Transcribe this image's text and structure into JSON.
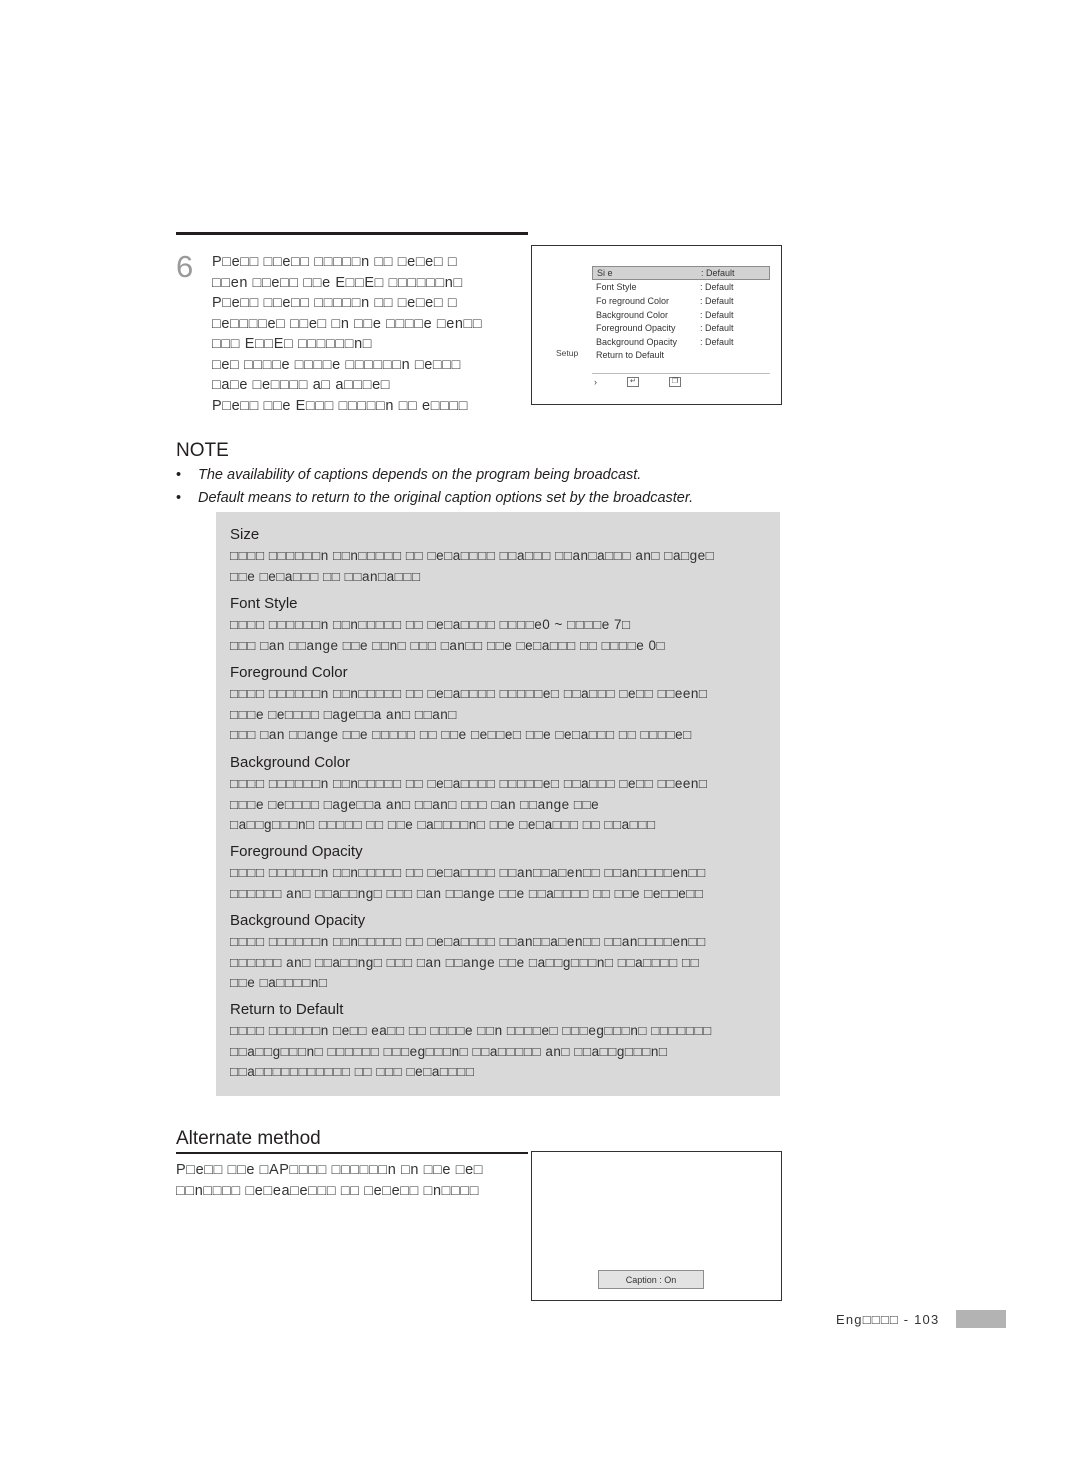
{
  "step": {
    "number": "6",
    "text": "P□e□□ □□e□□  □□□□□n □□ □e□e□ □\n□□en □□e□□ □□e E□□E□ □□□□□□n□\nP□e□□ □□e□□  □□□□□n □□ □e□e□ □\n□e□□□□e□ □□e□ □n □□e □□□□e □en□□\n□□□ E□□E□ □□□□□□n□\n□e□ □□□□e □□□□e □□□□□□n □e□□□\n□a□e □e□□□□ a□ a□□□e□\nP□e□□ □□e E□□□ □□□□□n □□ e□□□□"
  },
  "osd_top": {
    "setup_label": "Setup",
    "rows": [
      {
        "label": "Si e",
        "value": ": Default",
        "highlight": true
      },
      {
        "label": "Font Style",
        "value": ": Default",
        "highlight": false
      },
      {
        "label": "Fo reground Color",
        "value": ": Default",
        "highlight": false
      },
      {
        "label": "Background Color",
        "value": ": Default",
        "highlight": false
      },
      {
        "label": "Foreground Opacity",
        "value": ": Default",
        "highlight": false
      },
      {
        "label": "Background Opacity",
        "value": ": Default",
        "highlight": false
      },
      {
        "label": "Return to Default",
        "value": "",
        "highlight": false
      }
    ],
    "footer": {
      "move_icon": "›",
      "enter_icon": "↵",
      "return_icon": "❐"
    }
  },
  "note": {
    "title": "NOTE",
    "bullet": "•",
    "lines": [
      "The availability of captions depends on the program being broadcast.",
      "Default means to return to the original caption options set by the broadcaster."
    ]
  },
  "descriptions": [
    {
      "term": "Size",
      "body": "□□□□ □□□□□□n □□n□□□□□ □□ □e□a□□□□ □□a□□□ □□an□a□□□ an□ □a□ge□\n□□e □e□a□□□ □□ □□an□a□□□"
    },
    {
      "term": "Font Style",
      "body": "□□□□ □□□□□□n □□n□□□□□ □□ □e□a□□□□ □□□□e0 ~ □□□□e 7□\n□□□ □an □□ange □□e □□n□ □□□ □an□□ □□e □e□a□□□ □□ □□□□e 0□"
    },
    {
      "term": "Foreground Color",
      "body": "□□□□ □□□□□□n □□n□□□□□ □□ □e□a□□□□ □□□□□e□ □□a□□□ □e□□ □□een□\n□□□e □e□□□□ □age□□a an□ □□an□\n□□□ □an □□ange □□e □□□□□ □□ □□e □e□□e□ □□e □e□a□□□ □□ □□□□e□"
    },
    {
      "term": "Background Color",
      "body": "□□□□ □□□□□□n □□n□□□□□ □□ □e□a□□□□ □□□□□e□ □□a□□□ □e□□ □□een□\n□□□e □e□□□□ □age□□a an□ □□an□ □□□ □an □□ange □□e\n□a□□g□□□n□ □□□□□ □□ □□e □a□□□□n□ □□e □e□a□□□ □□ □□a□□□"
    },
    {
      "term": "Foreground Opacity",
      "body": "□□□□ □□□□□□n □□n□□□□□ □□ □e□a□□□□ □□an□□a□en□□ □□an□□□□en□□\n□□□□□□ an□ □□a□□ng□ □□□ □an □□ange □□e □□a□□□□ □□ □□e □e□□e□□"
    },
    {
      "term": "Background Opacity",
      "body": "□□□□ □□□□□□n □□n□□□□□ □□ □e□a□□□□ □□an□□a□en□□ □□an□□□□en□□\n□□□□□□ an□ □□a□□ng□ □□□ □an □□ange □□e □a□□g□□□n□ □□a□□□□ □□\n□□e □a□□□□n□"
    },
    {
      "term": "Return to Default",
      "body": "□□□□ □□□□□□n □e□□ ea□□ □□ □□□□e □□n □□□□e□ □□□eg□□□n□ □□□□□□□\n□□a□□g□□□n□ □□□□□□ □□□eg□□□n□ □□a□□□□□ an□ □□a□□g□□□n□\n□□a□□□□□□□□□□□ □□ □□□ □e□a□□□□"
    }
  ],
  "alternate": {
    "title": "Alternate method",
    "text": "P□e□□ □□e □AP□□□□ □□□□□□n □n □□e □e□\n□□n□□□□ □e□ea□e□□□ □□ □e□e□□ □n□□□□"
  },
  "osd_bottom": {
    "caption_chip": "Caption : On"
  },
  "footer": {
    "text": "Eng□□□□ - 103"
  }
}
